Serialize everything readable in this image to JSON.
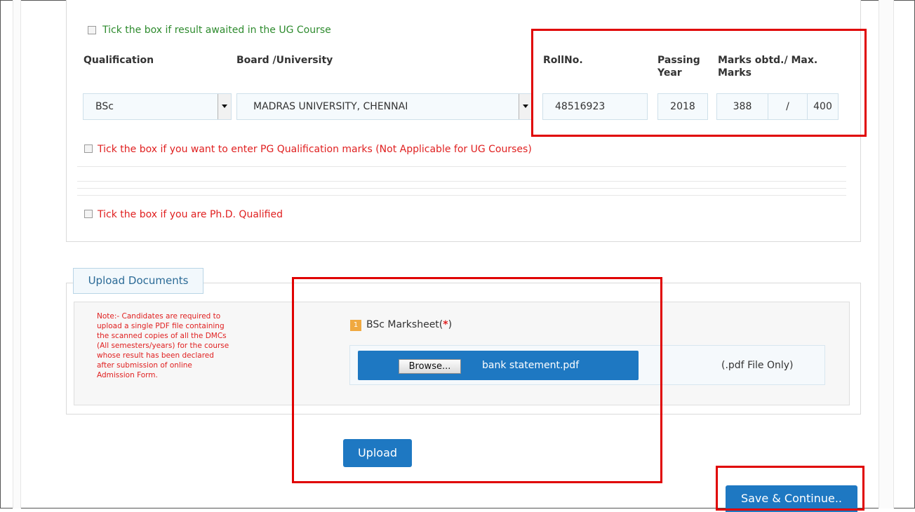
{
  "ug_result_checkbox": {
    "label": "Tick the box if result awaited in the UG Course",
    "checked": false
  },
  "columns": {
    "qualification": "Qualification",
    "board": "Board /University",
    "roll_no": "RollNo.",
    "passing_year_line1": "Passing",
    "passing_year_line2": "Year",
    "marks_line1": "Marks obtd./ Max.",
    "marks_line2": "Marks"
  },
  "row": {
    "qualification": "BSc",
    "board": "MADRAS UNIVERSITY, CHENNAI",
    "roll_no": "48516923",
    "passing_year": "2018",
    "marks_obtained": "388",
    "separator": "/",
    "max_marks": "400"
  },
  "pg_checkbox": {
    "label": "Tick the box if you want to enter PG Qualification marks (Not Applicable for UG Courses)",
    "checked": false
  },
  "phd_checkbox": {
    "label": "Tick the box if you are Ph.D. Qualified",
    "checked": false
  },
  "upload": {
    "tab_title": "Upload Documents",
    "note_lines": [
      "Note:- Candidates are required to",
      "upload a single PDF file containing",
      "the scanned copies of all the DMCs",
      "(All semesters/years) for the course",
      "whose result has been declared",
      "after submission of online",
      "Admission Form."
    ],
    "doc_number": "1",
    "doc_label": "BSc Marksheet(",
    "doc_required_mark": "*",
    "doc_label_end": ")",
    "browse_label": "Browse...",
    "file_name": "bank statement.pdf",
    "file_hint": "(.pdf File Only)",
    "upload_button": "Upload"
  },
  "save_button": "Save & Continue..",
  "colors": {
    "primary": "#1e78c2",
    "highlight": "#e00000",
    "error_text": "#e02020",
    "success_text": "#2e8b2e"
  }
}
